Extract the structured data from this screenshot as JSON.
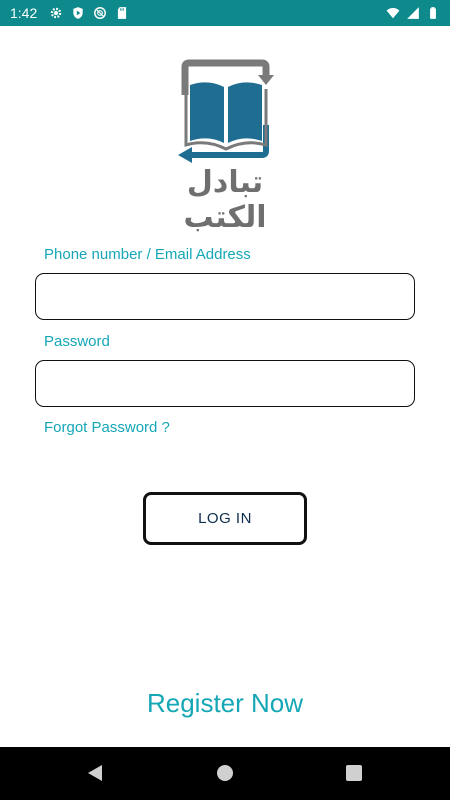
{
  "status_bar": {
    "time": "1:42",
    "left_icons": [
      "gear-icon",
      "shield-play-icon",
      "blocked-circle-icon",
      "sd-card-icon"
    ],
    "right_icons": [
      "wifi-icon",
      "cell-signal-icon",
      "battery-icon"
    ],
    "background": "#0f8a8c"
  },
  "logo": {
    "text": "تبادل الكتب",
    "book_color": "#1f6e92",
    "frame_color": "#7a7a7a"
  },
  "form": {
    "phone_label": "Phone number / Email Address",
    "phone_value": "",
    "password_label": "Password",
    "password_value": "",
    "forgot_password": "Forgot Password ?",
    "login_label": "LOG IN"
  },
  "register_label": "Register Now",
  "nav_bar": {
    "buttons": [
      "back-triangle-icon",
      "home-circle-icon",
      "recents-square-icon"
    ]
  },
  "colors": {
    "accent": "#15a7b6",
    "border": "#111111"
  }
}
